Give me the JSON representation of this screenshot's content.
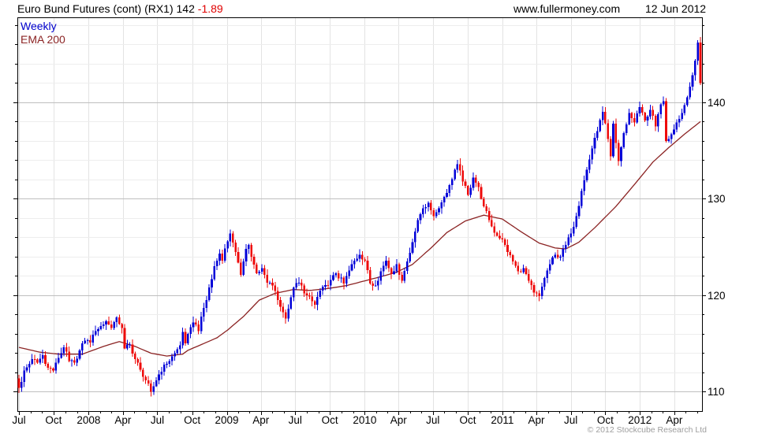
{
  "header": {
    "title_main": "Euro Bund Futures (cont) (RX1) 142 ",
    "title_change": "-1.89",
    "website": "www.fullermoney.com",
    "date": "12 Jun 2012"
  },
  "legend": {
    "weekly": "Weekly",
    "ema": "EMA 200"
  },
  "footer": {
    "copyright": "© 2012 Stockcube Research Ltd"
  },
  "colors": {
    "up_candle": "#0000d8",
    "down_candle": "#ee0a0a",
    "ema_line": "#8b2323",
    "title_change": "#e00000",
    "legend_weekly": "#0000cd",
    "grid_minor": "#ededed",
    "grid_major": "#bfbfbf",
    "grid_vertical": "#e3e3e3",
    "axis": "#000000",
    "label_text": "#000000",
    "copyright_text": "#9e9e9e"
  },
  "chart_data": {
    "type": "candlestick",
    "title": "Euro Bund Futures (cont) (RX1)",
    "frequency": "Weekly",
    "overlay": "EMA 200",
    "last_price": 142,
    "change": -1.89,
    "weeks": 259,
    "first_open": 111.4,
    "y_axis": {
      "min": 108,
      "max": 148.8,
      "majors": [
        110,
        120,
        130,
        140
      ],
      "minor_step": 2
    },
    "x_axis": {
      "ticks": [
        {
          "label": "Jul",
          "week": 0
        },
        {
          "label": "Oct",
          "week": 13.1
        },
        {
          "label": "2008",
          "week": 26.4
        },
        {
          "label": "Apr",
          "week": 39.4
        },
        {
          "label": "Jul",
          "week": 52.4
        },
        {
          "label": "Oct",
          "week": 65.6
        },
        {
          "label": "2009",
          "week": 78.7
        },
        {
          "label": "Apr",
          "week": 91.6
        },
        {
          "label": "Jul",
          "week": 104.6
        },
        {
          "label": "Oct",
          "week": 117.7
        },
        {
          "label": "2010",
          "week": 130.9
        },
        {
          "label": "Apr",
          "week": 143.7
        },
        {
          "label": "Jul",
          "week": 156.7
        },
        {
          "label": "Oct",
          "week": 169.9
        },
        {
          "label": "2011",
          "week": 183
        },
        {
          "label": "Apr",
          "week": 195.9
        },
        {
          "label": "Jul",
          "week": 208.9
        },
        {
          "label": "Oct",
          "week": 222
        },
        {
          "label": "2012",
          "week": 235.1
        },
        {
          "label": "Apr",
          "week": 248.1
        }
      ]
    },
    "close_anchors": [
      [
        0,
        110.4
      ],
      [
        1,
        111.0
      ],
      [
        2,
        112.2
      ],
      [
        4,
        112.9
      ],
      [
        5,
        113.4
      ],
      [
        7,
        113.0
      ],
      [
        9,
        113.8
      ],
      [
        11,
        112.5
      ],
      [
        13,
        112.2
      ],
      [
        15,
        113.5
      ],
      [
        17,
        114.6
      ],
      [
        19,
        113.2
      ],
      [
        21,
        113.0
      ],
      [
        23,
        114.3
      ],
      [
        25,
        115.3
      ],
      [
        27,
        115.1
      ],
      [
        29,
        116.3
      ],
      [
        31,
        116.8
      ],
      [
        33,
        117.3
      ],
      [
        35,
        116.6
      ],
      [
        37,
        117.7
      ],
      [
        39,
        116.6
      ],
      [
        40,
        114.5
      ],
      [
        42,
        114.9
      ],
      [
        44,
        113.4
      ],
      [
        46,
        112.3
      ],
      [
        48,
        111.2
      ],
      [
        50,
        110.0
      ],
      [
        52,
        111.2
      ],
      [
        53,
        111.8
      ],
      [
        55,
        112.8
      ],
      [
        57,
        113.2
      ],
      [
        59,
        114.0
      ],
      [
        61,
        114.8
      ],
      [
        62,
        116.2
      ],
      [
        63,
        115.0
      ],
      [
        64,
        116.0
      ],
      [
        66,
        117.2
      ],
      [
        68,
        116.3
      ],
      [
        69,
        117.8
      ],
      [
        71,
        119.5
      ],
      [
        72,
        120.8
      ],
      [
        74,
        123.0
      ],
      [
        76,
        124.3
      ],
      [
        77,
        123.6
      ],
      [
        79,
        125.6
      ],
      [
        80,
        126.4
      ],
      [
        82,
        124.5
      ],
      [
        83,
        123.4
      ],
      [
        84,
        122.1
      ],
      [
        86,
        124.8
      ],
      [
        87,
        125.2
      ],
      [
        88,
        124.0
      ],
      [
        90,
        122.3
      ],
      [
        92,
        122.8
      ],
      [
        94,
        121.3
      ],
      [
        96,
        121.0
      ],
      [
        99,
        118.8
      ],
      [
        101,
        117.6
      ],
      [
        103,
        119.8
      ],
      [
        104,
        120.8
      ],
      [
        106,
        121.3
      ],
      [
        109,
        120.0
      ],
      [
        112,
        119.0
      ],
      [
        114,
        120.5
      ],
      [
        117,
        121.0
      ],
      [
        120,
        122.3
      ],
      [
        123,
        121.2
      ],
      [
        126,
        123.2
      ],
      [
        129,
        124.2
      ],
      [
        131,
        123.6
      ],
      [
        133,
        121.2
      ],
      [
        135,
        121.0
      ],
      [
        137,
        122.5
      ],
      [
        139,
        123.6
      ],
      [
        141,
        122.2
      ],
      [
        143,
        123.2
      ],
      [
        145,
        121.5
      ],
      [
        147,
        123.5
      ],
      [
        149,
        125.5
      ],
      [
        151,
        127.8
      ],
      [
        153,
        129.0
      ],
      [
        155,
        129.6
      ],
      [
        157,
        128.2
      ],
      [
        159,
        129.0
      ],
      [
        161,
        130.2
      ],
      [
        163,
        131.4
      ],
      [
        165,
        133.0
      ],
      [
        166,
        133.6
      ],
      [
        168,
        131.8
      ],
      [
        170,
        130.4
      ],
      [
        172,
        132.2
      ],
      [
        174,
        131.2
      ],
      [
        176,
        129.2
      ],
      [
        178,
        127.8
      ],
      [
        180,
        126.5
      ],
      [
        183,
        125.8
      ],
      [
        185,
        124.5
      ],
      [
        187,
        123.5
      ],
      [
        189,
        122.5
      ],
      [
        191,
        122.8
      ],
      [
        193,
        121.5
      ],
      [
        195,
        120.3
      ],
      [
        197,
        119.9
      ],
      [
        199,
        121.8
      ],
      [
        201,
        123.2
      ],
      [
        203,
        124.2
      ],
      [
        205,
        124.0
      ],
      [
        207,
        125.2
      ],
      [
        209,
        126.4
      ],
      [
        211,
        128.2
      ],
      [
        213,
        130.8
      ],
      [
        215,
        133.0
      ],
      [
        217,
        135.2
      ],
      [
        219,
        137.0
      ],
      [
        221,
        139.0
      ],
      [
        223,
        136.2
      ],
      [
        224,
        134.4
      ],
      [
        225,
        137.8
      ],
      [
        227,
        133.9
      ],
      [
        229,
        136.8
      ],
      [
        231,
        138.9
      ],
      [
        233,
        137.9
      ],
      [
        235,
        139.5
      ],
      [
        237,
        138.1
      ],
      [
        239,
        139.2
      ],
      [
        241,
        137.5
      ],
      [
        243,
        139.8
      ],
      [
        244,
        140.1
      ],
      [
        245,
        136.0
      ],
      [
        247,
        136.7
      ],
      [
        249,
        137.9
      ],
      [
        251,
        138.9
      ],
      [
        253,
        140.5
      ],
      [
        255,
        142.8
      ],
      [
        256,
        144.3
      ],
      [
        257,
        146.2
      ],
      [
        258,
        142.0
      ]
    ],
    "ema_anchors": [
      [
        0,
        114.6
      ],
      [
        8,
        114.1
      ],
      [
        15,
        113.9
      ],
      [
        24,
        113.9
      ],
      [
        32,
        114.7
      ],
      [
        38,
        115.2
      ],
      [
        44,
        114.7
      ],
      [
        50,
        114.0
      ],
      [
        56,
        113.7
      ],
      [
        62,
        113.9
      ],
      [
        64,
        114.3
      ],
      [
        70,
        115.0
      ],
      [
        75,
        115.6
      ],
      [
        79,
        116.4
      ],
      [
        85,
        117.8
      ],
      [
        91,
        119.5
      ],
      [
        97,
        120.2
      ],
      [
        104,
        120.6
      ],
      [
        110,
        120.5
      ],
      [
        117,
        120.7
      ],
      [
        124,
        121.0
      ],
      [
        131,
        121.5
      ],
      [
        138,
        122.0
      ],
      [
        143,
        122.4
      ],
      [
        149,
        123.2
      ],
      [
        156,
        124.9
      ],
      [
        162,
        126.5
      ],
      [
        169,
        127.7
      ],
      [
        176,
        128.3
      ],
      [
        183,
        127.9
      ],
      [
        190,
        126.6
      ],
      [
        197,
        125.4
      ],
      [
        203,
        124.9
      ],
      [
        207,
        124.8
      ],
      [
        212,
        125.5
      ],
      [
        218,
        127.0
      ],
      [
        226,
        129.2
      ],
      [
        234,
        131.8
      ],
      [
        240,
        133.8
      ],
      [
        246,
        135.3
      ],
      [
        252,
        136.7
      ],
      [
        258,
        138.0
      ]
    ]
  }
}
